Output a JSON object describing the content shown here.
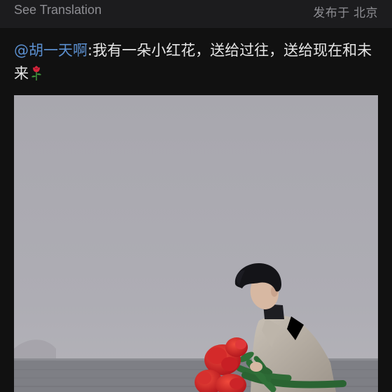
{
  "header": {
    "translate_label": "See Translation",
    "location_label": "发布于 北京"
  },
  "post": {
    "mention": "@胡一天啊",
    "body": ":我有一朵小红花，送给过往，送给现在和未来",
    "emoji": "rose-icon"
  },
  "photo": {
    "icon": "photo",
    "sky_color": "#a9a8b0",
    "sea_color": "#7f8086"
  },
  "colors": {
    "background": "#111111",
    "link": "#5b8fcf",
    "muted": "#8e8e93"
  }
}
